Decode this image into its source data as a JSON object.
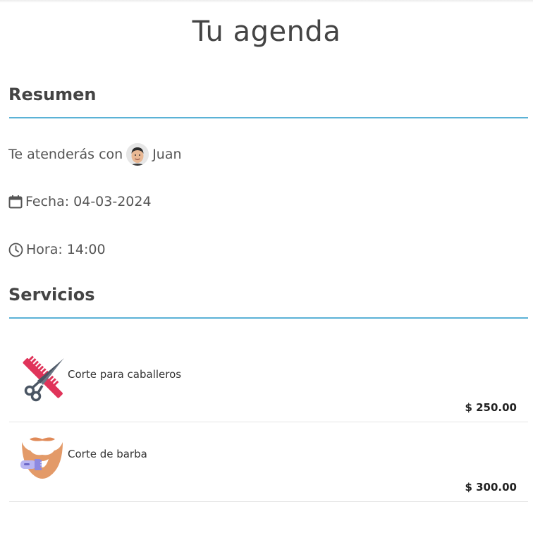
{
  "page": {
    "title": "Tu agenda"
  },
  "summary": {
    "heading": "Resumen",
    "attended_by_label": "Te atenderás con",
    "barber_name": "Juan",
    "date_text": "Fecha: 04-03-2024",
    "time_text": "Hora: 14:00",
    "icons": {
      "date": "calendar-icon",
      "time": "clock-icon",
      "barber": "avatar"
    }
  },
  "services": {
    "heading": "Servicios",
    "items": [
      {
        "name": "Corte para caballeros",
        "price": "$ 250.00",
        "icon": "scissors-comb-icon"
      },
      {
        "name": "Corte de barba",
        "price": "$ 300.00",
        "icon": "beard-trimmer-icon"
      }
    ]
  },
  "colors": {
    "accent_line": "#5bb2d6",
    "text": "#444444"
  }
}
